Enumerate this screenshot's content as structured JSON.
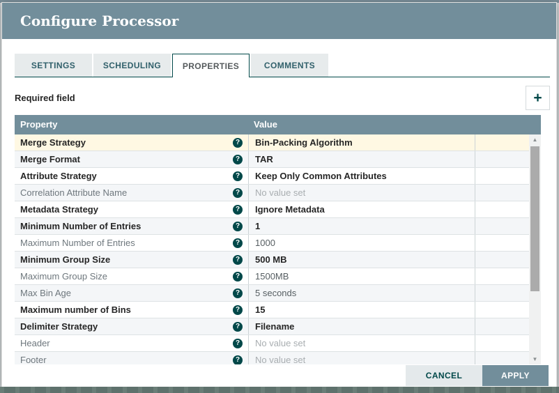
{
  "dialog": {
    "title": "Configure Processor"
  },
  "tabs": [
    {
      "label": "SETTINGS",
      "active": false
    },
    {
      "label": "SCHEDULING",
      "active": false
    },
    {
      "label": "PROPERTIES",
      "active": true
    },
    {
      "label": "COMMENTS",
      "active": false
    }
  ],
  "properties_panel": {
    "required_field_label": "Required field",
    "add_button_glyph": "+",
    "help_icon_glyph": "?"
  },
  "table": {
    "columns": {
      "property": "Property",
      "value": "Value"
    },
    "rows": [
      {
        "property": "Merge Strategy",
        "value": "Bin-Packing Algorithm",
        "required": true,
        "value_set": true,
        "highlighted": true
      },
      {
        "property": "Merge Format",
        "value": "TAR",
        "required": true,
        "value_set": true
      },
      {
        "property": "Attribute Strategy",
        "value": "Keep Only Common Attributes",
        "required": true,
        "value_set": true
      },
      {
        "property": "Correlation Attribute Name",
        "value": "No value set",
        "required": false,
        "value_set": false
      },
      {
        "property": "Metadata Strategy",
        "value": "Ignore Metadata",
        "required": true,
        "value_set": true
      },
      {
        "property": "Minimum Number of Entries",
        "value": "1",
        "required": true,
        "value_set": true
      },
      {
        "property": "Maximum Number of Entries",
        "value": "1000",
        "required": false,
        "value_set": true
      },
      {
        "property": "Minimum Group Size",
        "value": "500 MB",
        "required": true,
        "value_set": true
      },
      {
        "property": "Maximum Group Size",
        "value": "1500MB",
        "required": false,
        "value_set": true
      },
      {
        "property": "Max Bin Age",
        "value": "5 seconds",
        "required": false,
        "value_set": true
      },
      {
        "property": "Maximum number of Bins",
        "value": "15",
        "required": true,
        "value_set": true
      },
      {
        "property": "Delimiter Strategy",
        "value": "Filename",
        "required": true,
        "value_set": true
      },
      {
        "property": "Header",
        "value": "No value set",
        "required": false,
        "value_set": false
      },
      {
        "property": "Footer",
        "value": "No value set",
        "required": false,
        "value_set": false
      }
    ]
  },
  "scrollbar": {
    "up_glyph": "▲",
    "down_glyph": "▼"
  },
  "footer": {
    "cancel_label": "CANCEL",
    "apply_label": "APPLY"
  },
  "colors": {
    "header_slate": "#728E9B",
    "accent_dark_teal": "#004849",
    "selected_row_highlight": "#FFF8E3",
    "alt_row": "#F4F6F8",
    "unset_value_text": "#A9AEB1"
  }
}
